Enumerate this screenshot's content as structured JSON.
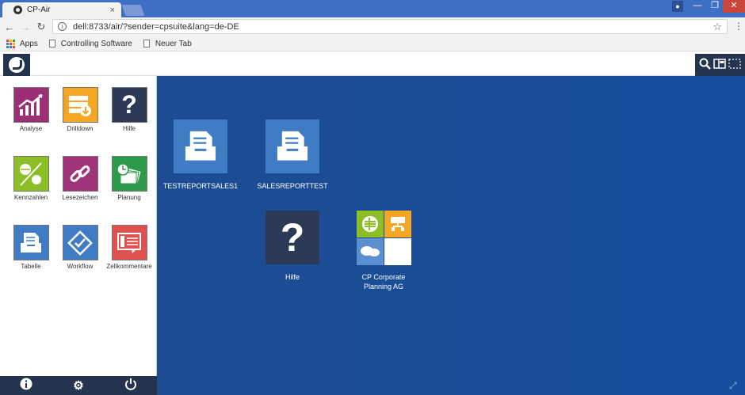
{
  "browser": {
    "tab_title": "CP-Air",
    "tab_close": "×",
    "url": "dell:8733/air/?sender=cpsuite&lang=de-DE",
    "window_min": "—",
    "window_max": "❐",
    "window_close": "✕",
    "bookmarks": [
      {
        "label": "Apps",
        "icon": "apps-grid-icon"
      },
      {
        "label": "Controlling Software",
        "icon": "page-icon"
      },
      {
        "label": "Neuer Tab",
        "icon": "page-icon"
      }
    ]
  },
  "sidebar": {
    "items": [
      {
        "label": "Analyse",
        "icon": "analysis-chart-icon",
        "color": "#9b2f74"
      },
      {
        "label": "Drilldown",
        "icon": "drilldown-icon",
        "color": "#f5a623"
      },
      {
        "label": "Hilfe",
        "icon": "help-icon",
        "color": "#2c3a57"
      },
      {
        "label": "Kennzahlen",
        "icon": "kpi-icon",
        "color": "#8cbf26"
      },
      {
        "label": "Lesezeichen",
        "icon": "bookmark-link-icon",
        "color": "#a03478"
      },
      {
        "label": "Planung",
        "icon": "planning-icon",
        "color": "#2e9a4c"
      },
      {
        "label": "Tabelle",
        "icon": "table-tray-icon",
        "color": "#3f7cc4"
      },
      {
        "label": "Workflow",
        "icon": "workflow-icon",
        "color": "#3f7cc4"
      },
      {
        "label": "Zellkommentare",
        "icon": "cell-comment-icon",
        "color": "#e0524f"
      }
    ],
    "footer": {
      "info": "i",
      "settings": "⚙",
      "power": "⏻"
    }
  },
  "desktop": {
    "items": [
      {
        "label": "TESTREPORTSALES1",
        "icon": "report-tray-icon",
        "color": "#3f7cc4"
      },
      {
        "label": "SALESREPORTTEST",
        "icon": "report-tray-icon",
        "color": "#3f7cc4"
      },
      {
        "label": "Hilfe",
        "icon": "help-icon",
        "color": "#2c3a57"
      },
      {
        "label_line1": "CP Corporate",
        "label_line2": "Planning AG",
        "icon": "cp-corporate-icon"
      }
    ]
  },
  "colors": {
    "header_dark": "#24344f",
    "chrome_blue": "#3f6fc4",
    "desktop_blue": "#1a4d97"
  }
}
